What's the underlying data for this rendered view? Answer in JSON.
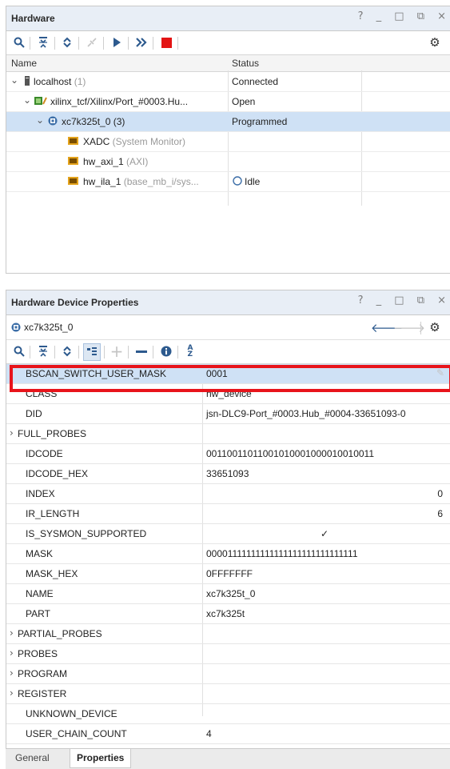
{
  "hardware": {
    "title": "Hardware",
    "window_controls": "? _ □ ⧉ ×",
    "toolbar": [
      "search-icon",
      "collapse-all-icon",
      "expand-all-icon",
      "auto-connect-icon",
      "run-trigger-icon",
      "run-immediate-icon",
      "stop-icon",
      "settings-icon"
    ],
    "columns": {
      "name": "Name",
      "status": "Status"
    },
    "tree": [
      {
        "label": "localhost",
        "suffix": " (1)",
        "status": "Connected"
      },
      {
        "label": "xilinx_tcf/Xilinx/Port_#0003.Hu...",
        "suffix": "",
        "status": "Open"
      },
      {
        "label": "xc7k325t_0",
        "suffix": " (3)",
        "status": "Programmed"
      },
      {
        "label": "XADC",
        "suffix": " (System Monitor)",
        "status": ""
      },
      {
        "label": "hw_axi_1",
        "suffix": " (AXI)",
        "status": ""
      },
      {
        "label": "hw_ila_1",
        "suffix": " (base_mb_i/sys...",
        "status": "Idle"
      }
    ]
  },
  "properties": {
    "title": "Hardware Device Properties",
    "window_controls": "? _ □ ⧉ ×",
    "device": "xc7k325t_0",
    "rows": [
      {
        "key": "BSCAN_SWITCH_USER_MASK",
        "value": "0001"
      },
      {
        "key": "CLASS",
        "value": "hw_device"
      },
      {
        "key": "DID",
        "value": "jsn-DLC9-Port_#0003.Hub_#0004-33651093-0"
      },
      {
        "key": "FULL_PROBES",
        "value": ""
      },
      {
        "key": "IDCODE",
        "value": "00110011011001010001000010010011"
      },
      {
        "key": "IDCODE_HEX",
        "value": "33651093"
      },
      {
        "key": "INDEX",
        "value": "0"
      },
      {
        "key": "IR_LENGTH",
        "value": "6"
      },
      {
        "key": "IS_SYSMON_SUPPORTED",
        "value": "✓"
      },
      {
        "key": "MASK",
        "value": "00001111111111111111111111111111"
      },
      {
        "key": "MASK_HEX",
        "value": "0FFFFFFF"
      },
      {
        "key": "NAME",
        "value": "xc7k325t_0"
      },
      {
        "key": "PART",
        "value": "xc7k325t"
      },
      {
        "key": "PARTIAL_PROBES",
        "value": ""
      },
      {
        "key": "PROBES",
        "value": ""
      },
      {
        "key": "PROGRAM",
        "value": ""
      },
      {
        "key": "REGISTER",
        "value": ""
      },
      {
        "key": "UNKNOWN_DEVICE",
        "value": ""
      },
      {
        "key": "USER_CHAIN_COUNT",
        "value": "4"
      }
    ]
  },
  "tabs": {
    "general": "General",
    "properties": "Properties"
  },
  "colors": {
    "highlight_box": "#e8141b",
    "selection": "#cfe1f5",
    "stop": "#e31414",
    "accent": "#2d5a8e"
  }
}
